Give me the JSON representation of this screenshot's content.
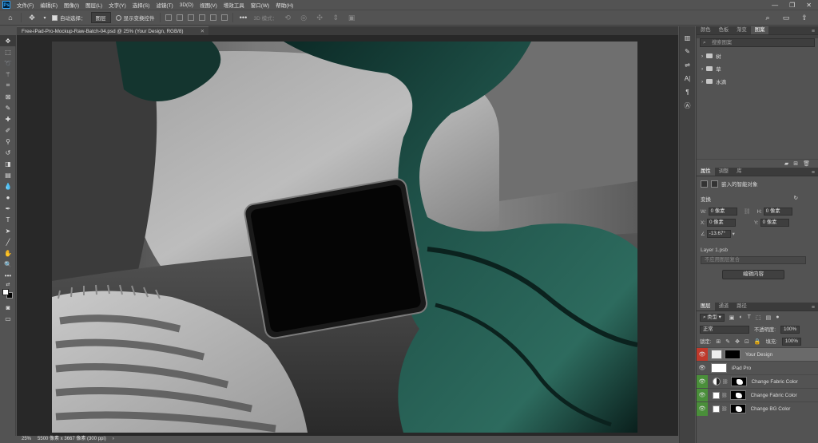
{
  "app": {
    "logo": "Ps",
    "menu": [
      "文件(F)",
      "编辑(E)",
      "图像(I)",
      "图层(L)",
      "文字(Y)",
      "选择(S)",
      "滤镜(T)",
      "3D(D)",
      "视图(V)",
      "增效工具",
      "窗口(W)",
      "帮助(H)"
    ],
    "window_controls": [
      "—",
      "❐",
      "✕"
    ]
  },
  "options_bar": {
    "auto_select_label": "自动选择：",
    "auto_select_value": "图层",
    "transform_controls_label": "显示变换控件",
    "mode_3d_label": "3D 模式："
  },
  "document": {
    "tab_title": "Free-iPad-Pro-Mockup-Raw-Batch-04.psd @ 25% (Your Design, RGB/8)",
    "zoom": "25%",
    "doc_info": "5500 像素 x 3667 像素 (300 ppi)"
  },
  "swatches_panel": {
    "tabs": [
      "颜色",
      "色板",
      "渐变",
      "图案"
    ],
    "active_tab": "图案",
    "search_placeholder": "搜索图案",
    "groups": [
      "树",
      "草",
      "水滴"
    ]
  },
  "properties_panel": {
    "tabs": [
      "属性",
      "调整",
      "库"
    ],
    "active_tab": "属性",
    "object_type": "嵌入的智能对象",
    "transform_label": "变换",
    "w_label": "W:",
    "w_value": "0 像素",
    "h_label": "H:",
    "h_value": "0 像素",
    "x_label": "X:",
    "x_value": "0 像素",
    "y_label": "Y:",
    "y_value": "0 像素",
    "angle_value": "-13.67°",
    "file_name": "Layer 1.psb",
    "comp_dropdown": "不应用图层复合",
    "edit_button": "编辑内容"
  },
  "layers_panel": {
    "tabs": [
      "图层",
      "通道",
      "路径"
    ],
    "active_tab": "图层",
    "filter_type": "类型",
    "blend_mode": "正常",
    "opacity_label": "不透明度:",
    "opacity_value": "100%",
    "lock_label": "锁定:",
    "fill_label": "填充:",
    "fill_value": "100%",
    "layers": [
      {
        "name": "Your Design",
        "selected": true,
        "eye_color": "red"
      },
      {
        "name": "iPad Pro",
        "selected": false,
        "eye_color": "none"
      },
      {
        "name": "Change Fabric Color",
        "selected": false,
        "eye_color": "green"
      },
      {
        "name": "Change Fabric Color",
        "selected": false,
        "eye_color": "green"
      },
      {
        "name": "Change BG Color",
        "selected": false,
        "eye_color": "green"
      }
    ]
  }
}
